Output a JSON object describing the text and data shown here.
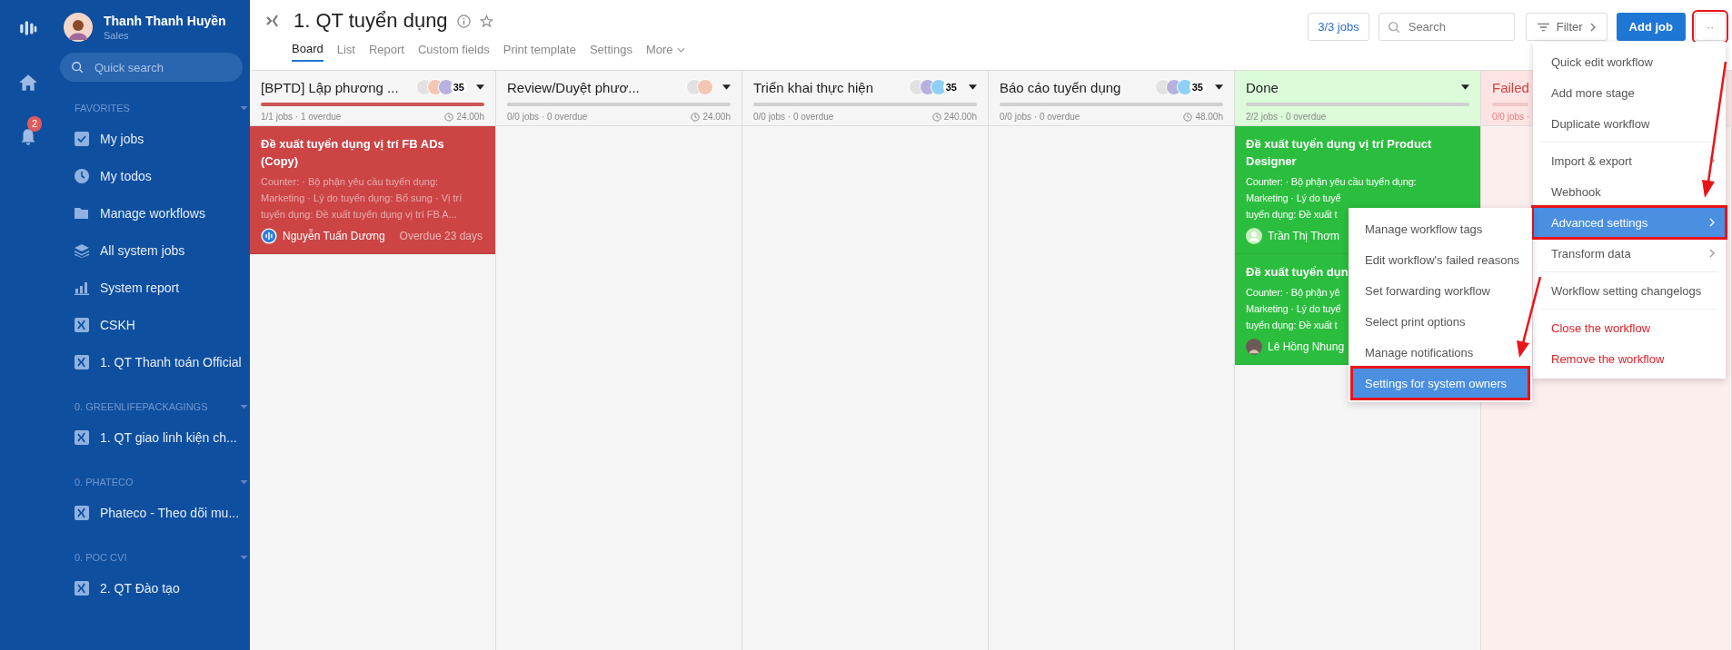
{
  "user": {
    "name": "Thanh Thanh Huyền",
    "role": "Sales"
  },
  "rail": {
    "notifications": "2"
  },
  "search": {
    "placeholder": "Quick search"
  },
  "sections": [
    {
      "title": "FAVORITES",
      "items": [
        {
          "kind": "check",
          "label": "My jobs"
        },
        {
          "kind": "clock",
          "label": "My todos"
        },
        {
          "kind": "folder",
          "label": "Manage workflows"
        },
        {
          "kind": "layers",
          "label": "All system jobs"
        },
        {
          "kind": "chart",
          "label": "System report"
        },
        {
          "kind": "workflow",
          "label": "CSKH"
        },
        {
          "kind": "workflow",
          "label": "1. QT Thanh toán Official"
        }
      ]
    },
    {
      "title": "0. GREENLIFEPACKAGINGS",
      "items": [
        {
          "kind": "workflow",
          "label": "1. QT giao linh kiện ch..."
        }
      ]
    },
    {
      "title": "0. PHATECO",
      "items": [
        {
          "kind": "workflow",
          "label": "Phateco - Theo dõi mu..."
        }
      ]
    },
    {
      "title": "0. POC CVI",
      "items": [
        {
          "kind": "workflow",
          "label": "2. QT Đào tạo"
        }
      ]
    }
  ],
  "workflow": {
    "title": "1. QT tuyển dụng"
  },
  "tabs": [
    {
      "label": "Board",
      "selected": true
    },
    {
      "label": "List",
      "selected": false
    },
    {
      "label": "Report",
      "selected": false
    },
    {
      "label": "Custom fields",
      "selected": false
    },
    {
      "label": "Print template",
      "selected": false
    },
    {
      "label": "Settings",
      "selected": false
    },
    {
      "label": "More",
      "selected": false
    }
  ],
  "toolbar": {
    "jobs": "3/3 jobs",
    "search_placeholder": "Search",
    "filter": "Filter",
    "add": "Add job",
    "more": "··",
    "more_highlighted": true
  },
  "stages": [
    {
      "kind": "normal",
      "name": "[BPTD] Lập phương ...",
      "avatars": [
        {
          "color": "#e2e2e2"
        },
        {
          "color": "#f4c7b5"
        },
        {
          "color": "#b7b1df"
        }
      ],
      "count": "35",
      "level": 1,
      "meta": "1/1 jobs · 1 overdue",
      "time": "24.00h",
      "cards": [
        {
          "color": "#cc4444",
          "title": "Đề xuất tuyển dụng vị trí FB ADs (Copy)",
          "lines": [
            "Counter: · Bộ phận yêu cầu tuyển dụng:",
            "Marketing · Lý do tuyển dụng: Bổ sung · Vị trí",
            "tuyển dụng: Đề xuất tuyển dụng vị trí FB A..."
          ],
          "assignee": "Nguyễn Tuấn Dương",
          "due": "Overdue 23 days"
        }
      ]
    },
    {
      "kind": "normal",
      "name": "Review/Duyệt phươ...",
      "avatars": [
        {
          "color": "#e2e2e2"
        },
        {
          "color": "#f4c7b5"
        }
      ],
      "meta": "0/0 jobs · 0 overdue",
      "time": "24.00h"
    },
    {
      "kind": "normal",
      "name": "Triển khai thực hiện",
      "avatars": [
        {
          "color": "#e2e2e2"
        },
        {
          "color": "#b7b1df"
        },
        {
          "color": "#8fd0f5"
        }
      ],
      "count": "35",
      "meta": "0/0 jobs · 0 overdue",
      "time": "240.00h"
    },
    {
      "kind": "normal",
      "name": "Báo cáo tuyển dụng",
      "avatars": [
        {
          "color": "#e2e2e2"
        },
        {
          "color": "#b7b1df"
        },
        {
          "color": "#8fd0f5"
        }
      ],
      "count": "35",
      "meta": "0/0 jobs · 0 overdue",
      "time": "48.00h"
    },
    {
      "kind": "done",
      "name": "Done",
      "meta": "2/2 jobs · 0 overdue",
      "cards": [
        {
          "color": "#2bbd3e",
          "title": "Đề xuất tuyển dụng vị trí Product Designer",
          "lines": [
            "Counter: · Bộ phận yêu cầu tuyển dụng:",
            "Marketing · Lý do tuyể",
            "tuyển dụng: Đề xuất t"
          ],
          "assignee": "Trần Thị Thơm"
        },
        {
          "color": "#2bbd3e",
          "title": "Đề xuất tuyển dụn",
          "lines": [
            "Counter: · Bộ phận yê",
            "Marketing · Lý do tuyể",
            "tuyển dụng: Đề xuất t"
          ],
          "assignee": "Lê Hồng Nhung"
        }
      ]
    },
    {
      "kind": "failed",
      "name": "Failed",
      "meta": "0/0 jobs ·"
    }
  ],
  "menu": [
    {
      "label": "Quick edit workflow",
      "submenu": false,
      "selected": false,
      "danger": false,
      "divider_before": false
    },
    {
      "label": "Add more stage",
      "submenu": false,
      "selected": false,
      "danger": false,
      "divider_before": false
    },
    {
      "label": "Duplicate workflow",
      "submenu": false,
      "selected": false,
      "danger": false,
      "divider_before": false
    },
    {
      "label": "Import & export",
      "submenu": true,
      "selected": false,
      "danger": false,
      "divider_before": true
    },
    {
      "label": "Webhook",
      "submenu": false,
      "selected": false,
      "danger": false,
      "divider_before": false
    },
    {
      "label": "Advanced settings",
      "submenu": true,
      "selected": true,
      "danger": false,
      "divider_before": false,
      "highlighted": true
    },
    {
      "label": "Transform data",
      "submenu": true,
      "selected": false,
      "danger": false,
      "divider_before": false
    },
    {
      "label": "Workflow setting changelogs",
      "submenu": false,
      "selected": false,
      "danger": false,
      "divider_before": true
    },
    {
      "label": "Close the workflow",
      "submenu": false,
      "selected": false,
      "danger": true,
      "divider_before": true
    },
    {
      "label": "Remove the workflow",
      "submenu": false,
      "selected": false,
      "danger": true,
      "divider_before": false
    }
  ],
  "submenu": [
    {
      "label": "Manage workflow tags",
      "selected": false
    },
    {
      "label": "Edit workflow's failed reasons",
      "selected": false
    },
    {
      "label": "Set forwarding workflow",
      "selected": false
    },
    {
      "label": "Select print options",
      "selected": false
    },
    {
      "label": "Manage notifications",
      "selected": false
    },
    {
      "label": "Settings for system owners",
      "selected": true,
      "highlighted": true
    }
  ]
}
